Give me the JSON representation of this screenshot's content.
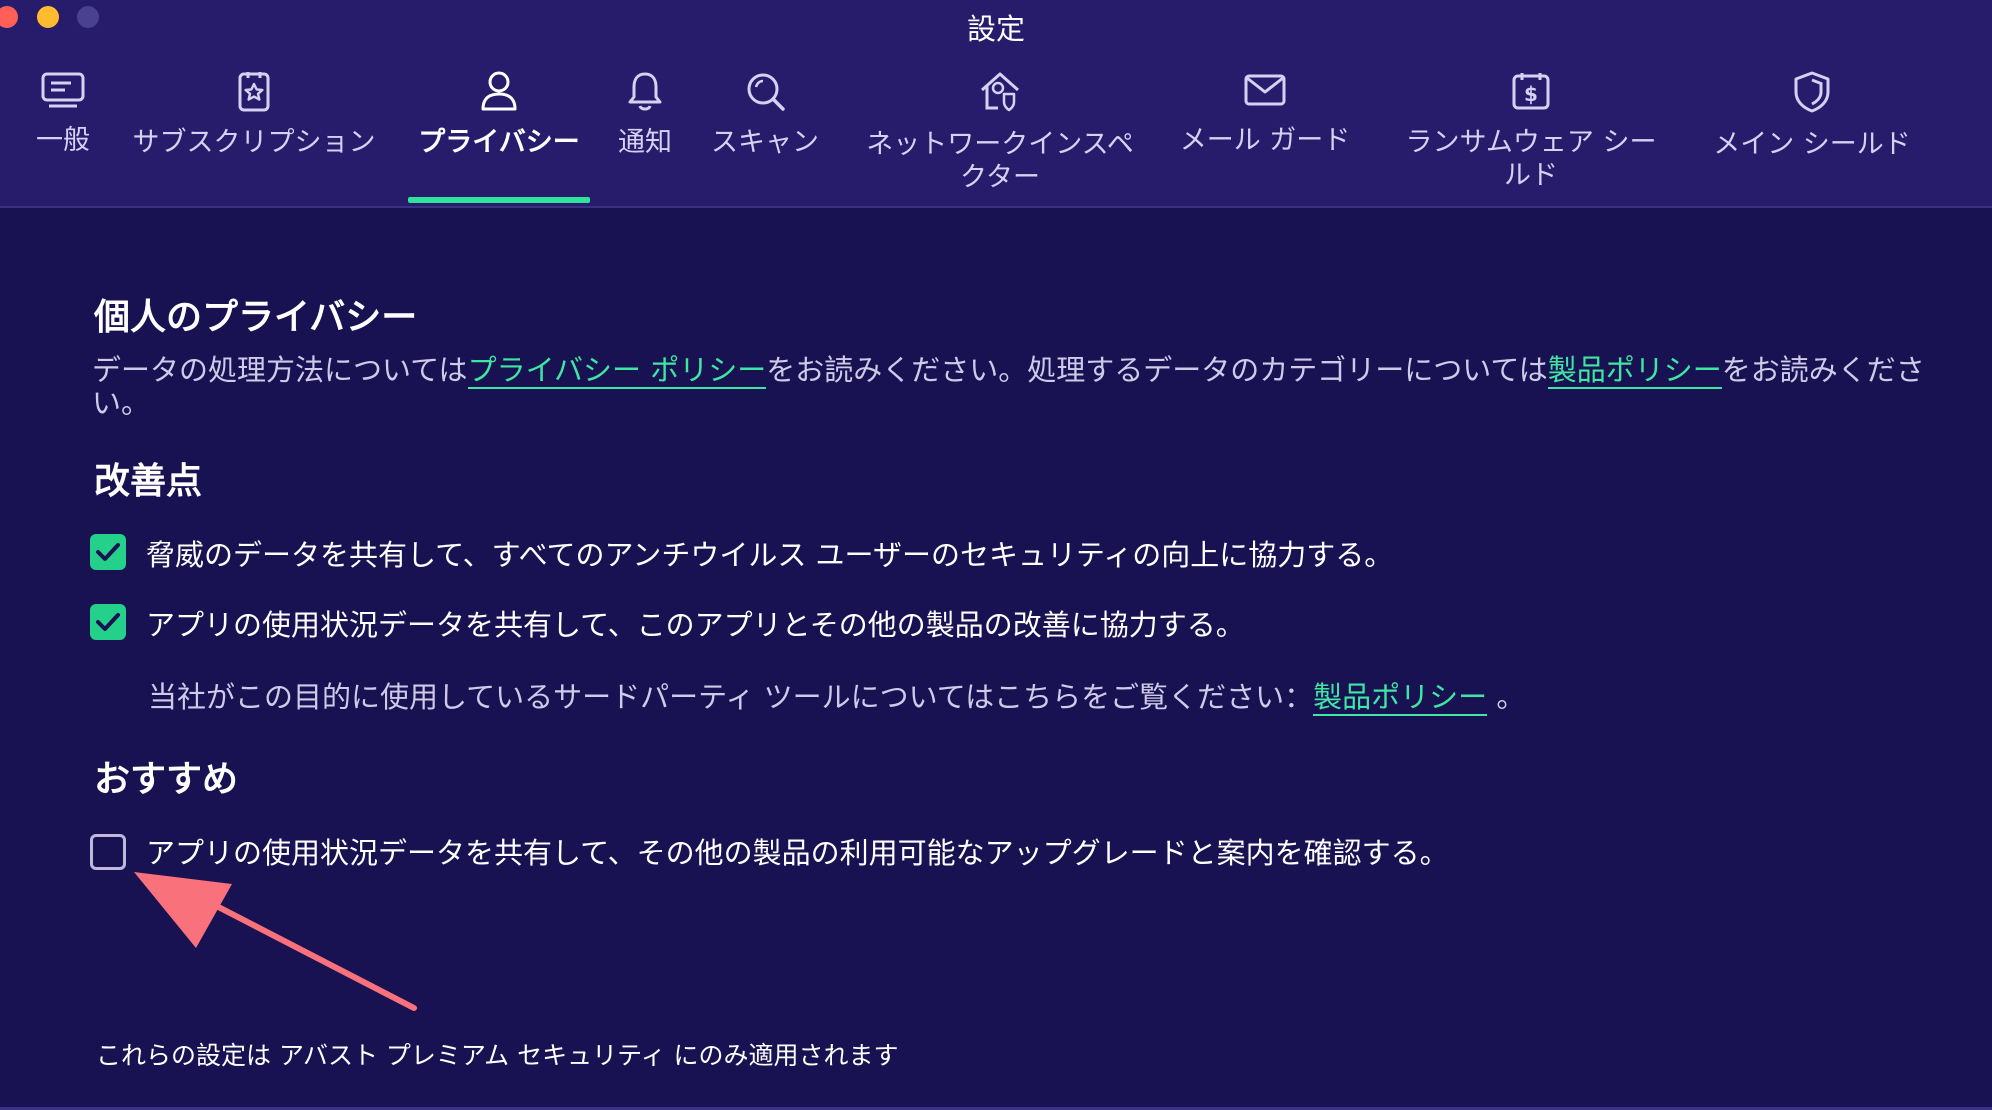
{
  "window": {
    "title": "設定",
    "traffic_lights": {
      "close": "#fe5f57",
      "minimize": "#febc2e",
      "zoom": "#4a4290"
    }
  },
  "tabs": [
    {
      "label": "一般",
      "icon": "monitor-icon"
    },
    {
      "label": "サブスクリプション",
      "icon": "subscription-star-icon"
    },
    {
      "label": "プライバシー",
      "icon": "person-icon",
      "active": true
    },
    {
      "label": "通知",
      "icon": "bell-icon"
    },
    {
      "label": "スキャン",
      "icon": "search-icon"
    },
    {
      "label": "ネットワークインスペ\nクター",
      "icon": "network-house-shield-icon"
    },
    {
      "label": "メール ガード",
      "icon": "envelope-icon"
    },
    {
      "label": "ランサムウェア シー\nルド",
      "icon": "ransomware-dollar-icon"
    },
    {
      "label": "メイン シールド",
      "icon": "shield-icon"
    }
  ],
  "privacy": {
    "heading": "個人のプライバシー",
    "text_1": "データの処理方法については",
    "link_privacy_policy": "プライバシー ポリシー",
    "text_2": "をお読みください。処理するデータのカテゴリーについては",
    "link_product_policy": "製品ポリシー",
    "text_3": "をお読みください。"
  },
  "improvements": {
    "heading": "改善点",
    "items": [
      {
        "label": "脅威のデータを共有して、すべてのアンチウイルス ユーザーのセキュリティの向上に協力する。",
        "checked": true
      },
      {
        "label": "アプリの使用状況データを共有して、このアプリとその他の製品の改善に協力する。",
        "checked": true
      }
    ],
    "note_text": "当社がこの目的に使用しているサードパーティ ツールについてはこちらをご覧ください：",
    "note_link": "製品ポリシー",
    "note_end": "。"
  },
  "recommendations": {
    "heading": "おすすめ",
    "items": [
      {
        "label": "アプリの使用状況データを共有して、その他の製品の利用可能なアップグレードと案内を確認する。",
        "checked": false
      }
    ]
  },
  "footer": "これらの設定は アバスト プレミアム セキュリティ にのみ適用されます",
  "colors": {
    "background": "#181152",
    "header": "#261c6b",
    "accent": "#2fe39a",
    "checkbox_on": "#23d18b",
    "annotation_arrow": "#f9727b"
  }
}
